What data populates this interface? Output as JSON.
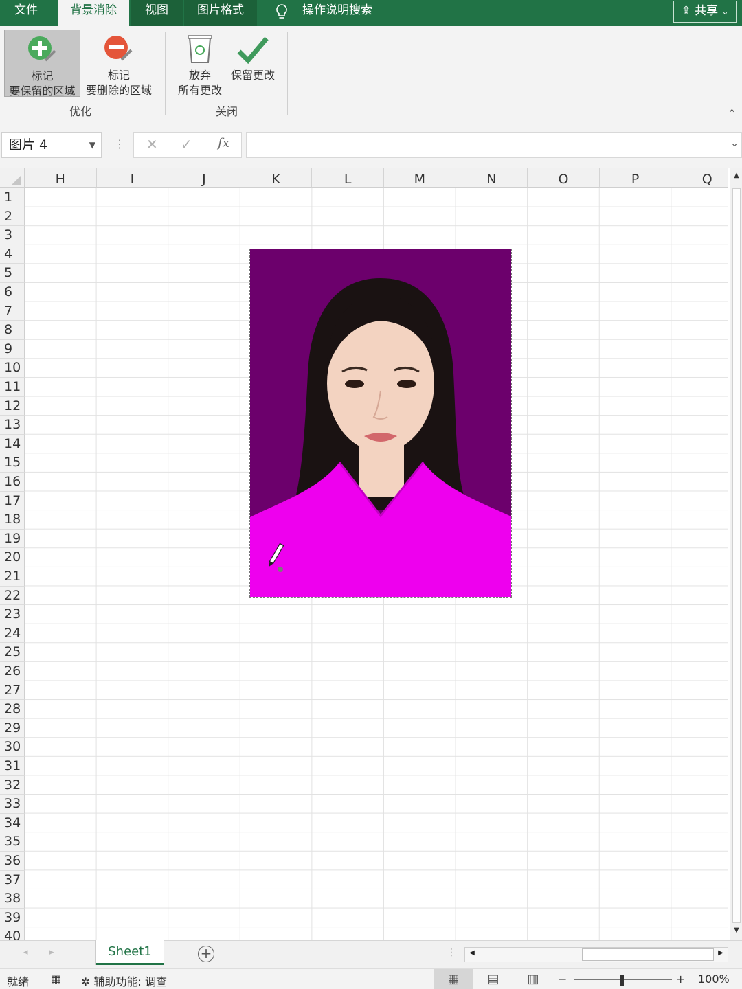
{
  "tabs": {
    "file": "文件",
    "background_removal": "背景消除",
    "view": "视图",
    "picture_format": "图片格式",
    "tell_me": "操作说明搜索",
    "share": "共享"
  },
  "ribbon": {
    "mark_keep_line1": "标记",
    "mark_keep_line2": "要保留的区域",
    "mark_remove_line1": "标记",
    "mark_remove_line2": "要删除的区域",
    "group_refine": "优化",
    "discard_line1": "放弃",
    "discard_line2": "所有更改",
    "keep_changes": "保留更改",
    "group_close": "关闭"
  },
  "formula_bar": {
    "name_box": "图片 4",
    "cancel_symbol": "✕",
    "enter_symbol": "✓",
    "fx_symbol": "fx",
    "content": ""
  },
  "grid": {
    "columns": [
      "H",
      "I",
      "J",
      "K",
      "L",
      "M",
      "N",
      "O",
      "P",
      "Q"
    ],
    "rows": [
      "1",
      "2",
      "3",
      "4",
      "5",
      "6",
      "7",
      "8",
      "9",
      "10",
      "11",
      "12",
      "13",
      "14",
      "15",
      "16",
      "17",
      "18",
      "19",
      "20",
      "21",
      "22",
      "23",
      "24",
      "25",
      "26",
      "27",
      "28",
      "29",
      "30",
      "31",
      "32",
      "33",
      "34",
      "35",
      "36",
      "37",
      "38",
      "39",
      "40"
    ]
  },
  "picture": {
    "background_color": "#6c006c",
    "shirt_color": "#ee00ee",
    "hair_color": "#1a1212",
    "skin_color": "#f3d3c1"
  },
  "sheets": {
    "active": "Sheet1"
  },
  "status": {
    "ready": "就绪",
    "accessibility": "辅助功能: 调查",
    "zoom": "100%",
    "zoom_minus": "−",
    "zoom_plus": "+"
  },
  "colors": {
    "accent": "#217346"
  }
}
